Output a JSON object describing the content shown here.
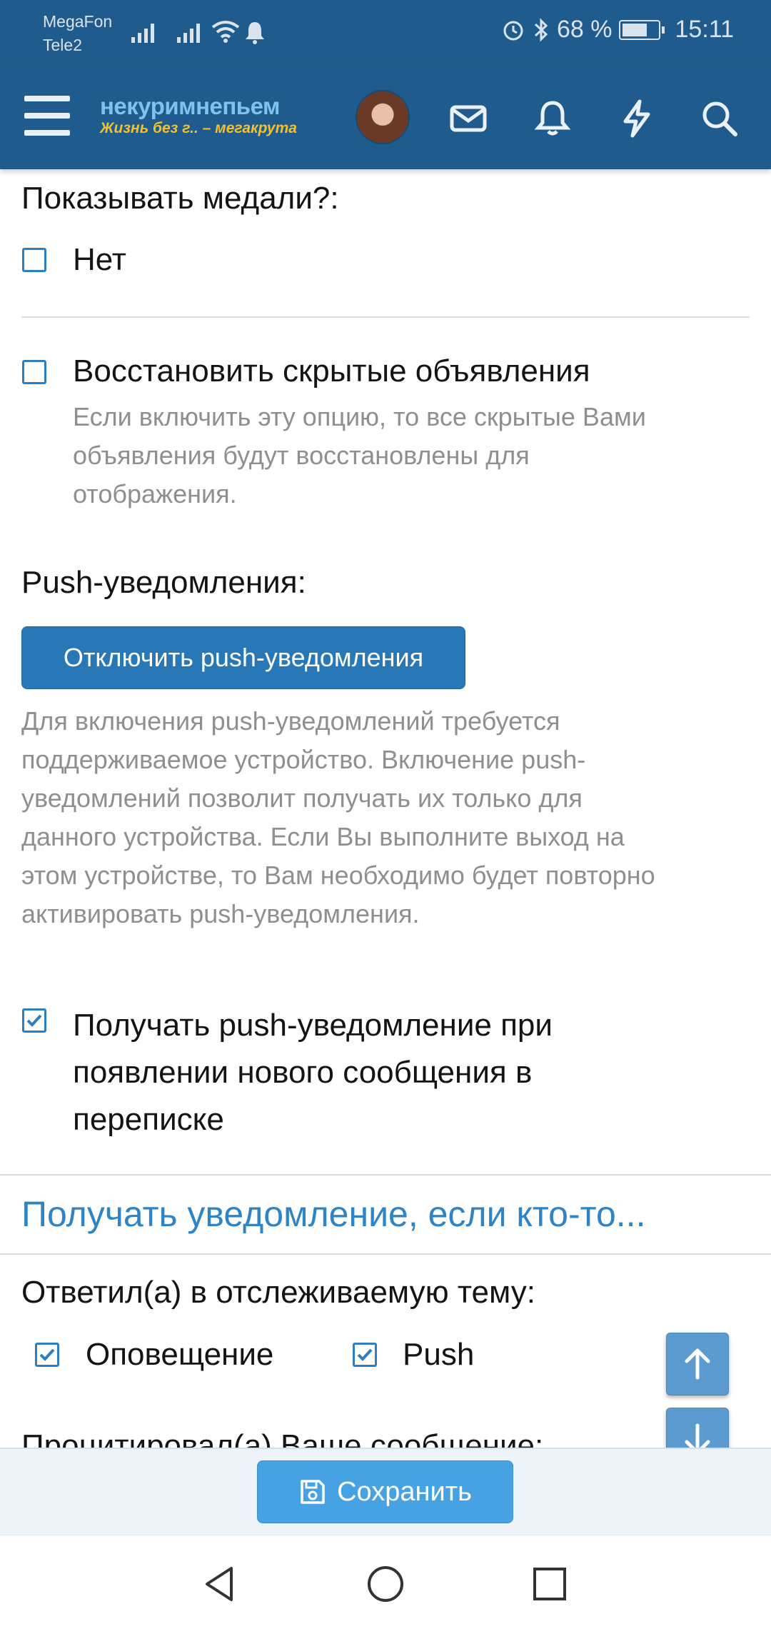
{
  "status_bar": {
    "carrier1": "MegaFon",
    "carrier2": "Tele2",
    "battery": "68 %",
    "time": "15:11"
  },
  "header": {
    "logo_line1": "некуримнепьем",
    "logo_line2": "Жизнь без г.. – мегакрута",
    "icons": [
      "menu-icon",
      "mail-icon",
      "bell-icon",
      "lightning-icon",
      "search-icon"
    ]
  },
  "medals": {
    "label": "Показывать медали?:",
    "option_label": "Нет",
    "checked": false
  },
  "restore_ads": {
    "label": "Восстановить скрытые объявления",
    "hint_lines": [
      "Если включить эту опцию, то все скрытые Вами",
      "объявления будут восстановлены для",
      "отображения."
    ],
    "checked": false
  },
  "push": {
    "label": "Push-уведомления:",
    "button_label": "Отключить push-уведомления",
    "hint_lines": [
      "Для включения push-уведомлений требуется",
      "поддерживаемое устройство. Включение push-",
      "уведомлений позволит получать их только для",
      "данного устройства. Если Вы выполните выход на",
      "этом устройстве, то Вам необходимо будет повторно",
      "активировать push-уведомления."
    ]
  },
  "push_conversation": {
    "label_lines": [
      "Получать push-уведомление при",
      "появлении нового сообщения в",
      "переписке"
    ],
    "checked": true
  },
  "notify_section": {
    "heading": "Получать уведомление, если кто-то...",
    "replied_label": "Ответил(а) в отслеживаемую тему:",
    "alert_label": "Оповещение",
    "push_label": "Push",
    "next_label_partial": "Процитировал(а) Ваше сообщение:"
  },
  "footer": {
    "save_label": "Сохранить"
  },
  "colors": {
    "header_bg": "#1f5b8c",
    "accent": "#2878b7",
    "link": "#2f84c6",
    "save_button": "#47a2e4"
  }
}
